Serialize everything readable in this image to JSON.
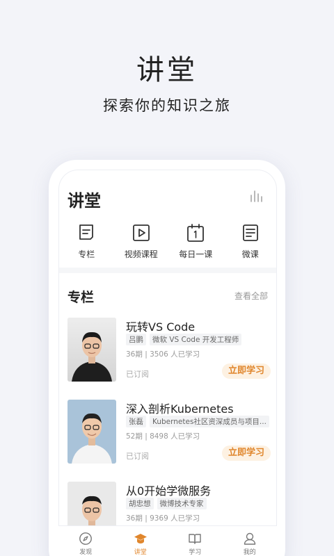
{
  "hero": {
    "title": "讲堂",
    "subtitle": "探索你的知识之旅"
  },
  "app": {
    "title": "讲堂",
    "right_icon": "bar-chart-icon"
  },
  "quick_links": [
    {
      "label": "专栏",
      "icon": "column-icon"
    },
    {
      "label": "视频课程",
      "icon": "video-icon"
    },
    {
      "label": "每日一课",
      "icon": "calendar-icon"
    },
    {
      "label": "微课",
      "icon": "micro-course-icon"
    }
  ],
  "section": {
    "title": "专栏",
    "more": "查看全部"
  },
  "courses": [
    {
      "title": "玩转VS Code",
      "author": "吕鹏",
      "role": "微软 VS Code 开发工程师",
      "meta": "36期 | 3506 人已学习",
      "status": "已订阅",
      "button": "立即学习"
    },
    {
      "title": "深入剖析Kubernetes",
      "author": "张磊",
      "role": "Kubernetes社区资深成员与项目...",
      "meta": "52期 | 8498 人已学习",
      "status": "已订阅",
      "button": "立即学习"
    },
    {
      "title": "从0开始学微服务",
      "author": "胡忠想",
      "role": "微博技术专家",
      "meta": "36期 | 9369 人已学习"
    }
  ],
  "bottom_nav": [
    {
      "label": "发现",
      "icon": "compass-icon",
      "active": false
    },
    {
      "label": "讲堂",
      "icon": "graduation-cap-icon",
      "active": true
    },
    {
      "label": "学习",
      "icon": "book-icon",
      "active": false
    },
    {
      "label": "我的",
      "icon": "user-icon",
      "active": false
    }
  ],
  "colors": {
    "accent": "#e0862c",
    "accent_bg": "#fdf1e2",
    "page_bg": "#f3f4f9"
  }
}
